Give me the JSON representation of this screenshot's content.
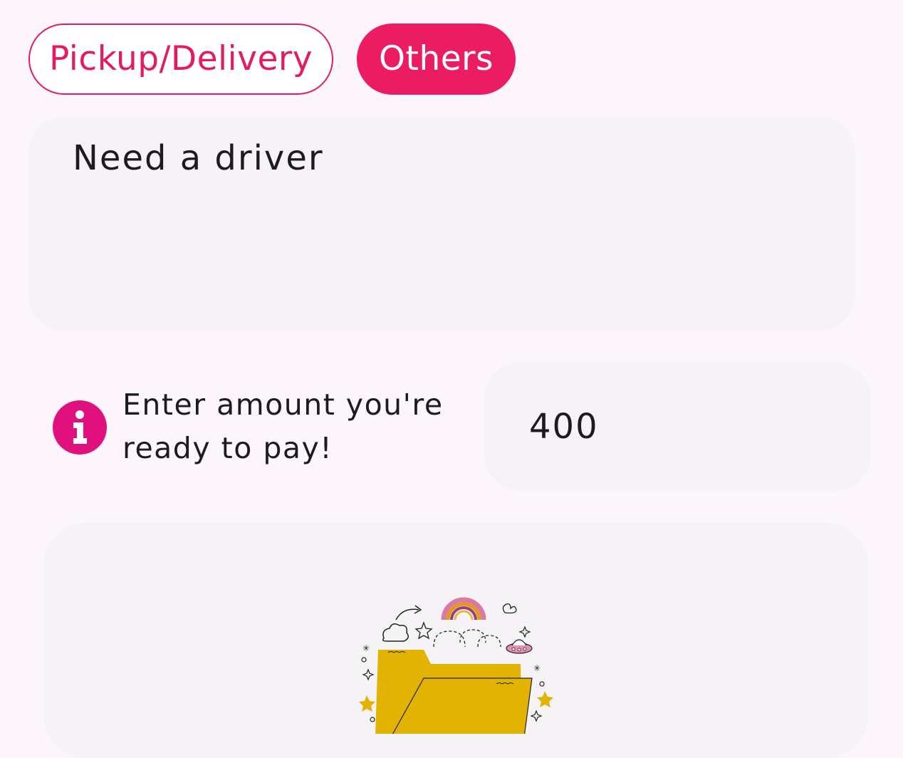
{
  "tabs": [
    {
      "label": "Pickup/Delivery",
      "selected": false
    },
    {
      "label": "Others",
      "selected": true
    }
  ],
  "description": {
    "value": "Need a driver"
  },
  "amount": {
    "label": "Enter amount you're ready to pay!",
    "value": "400",
    "info_icon": "info-icon"
  },
  "upload": {
    "illustration": "folder-illustration"
  },
  "colors": {
    "accent": "#ec1c63",
    "info": "#e0117f",
    "background": "#fdf5fc",
    "field": "#f5f3f6",
    "folder": "#e2b303"
  }
}
